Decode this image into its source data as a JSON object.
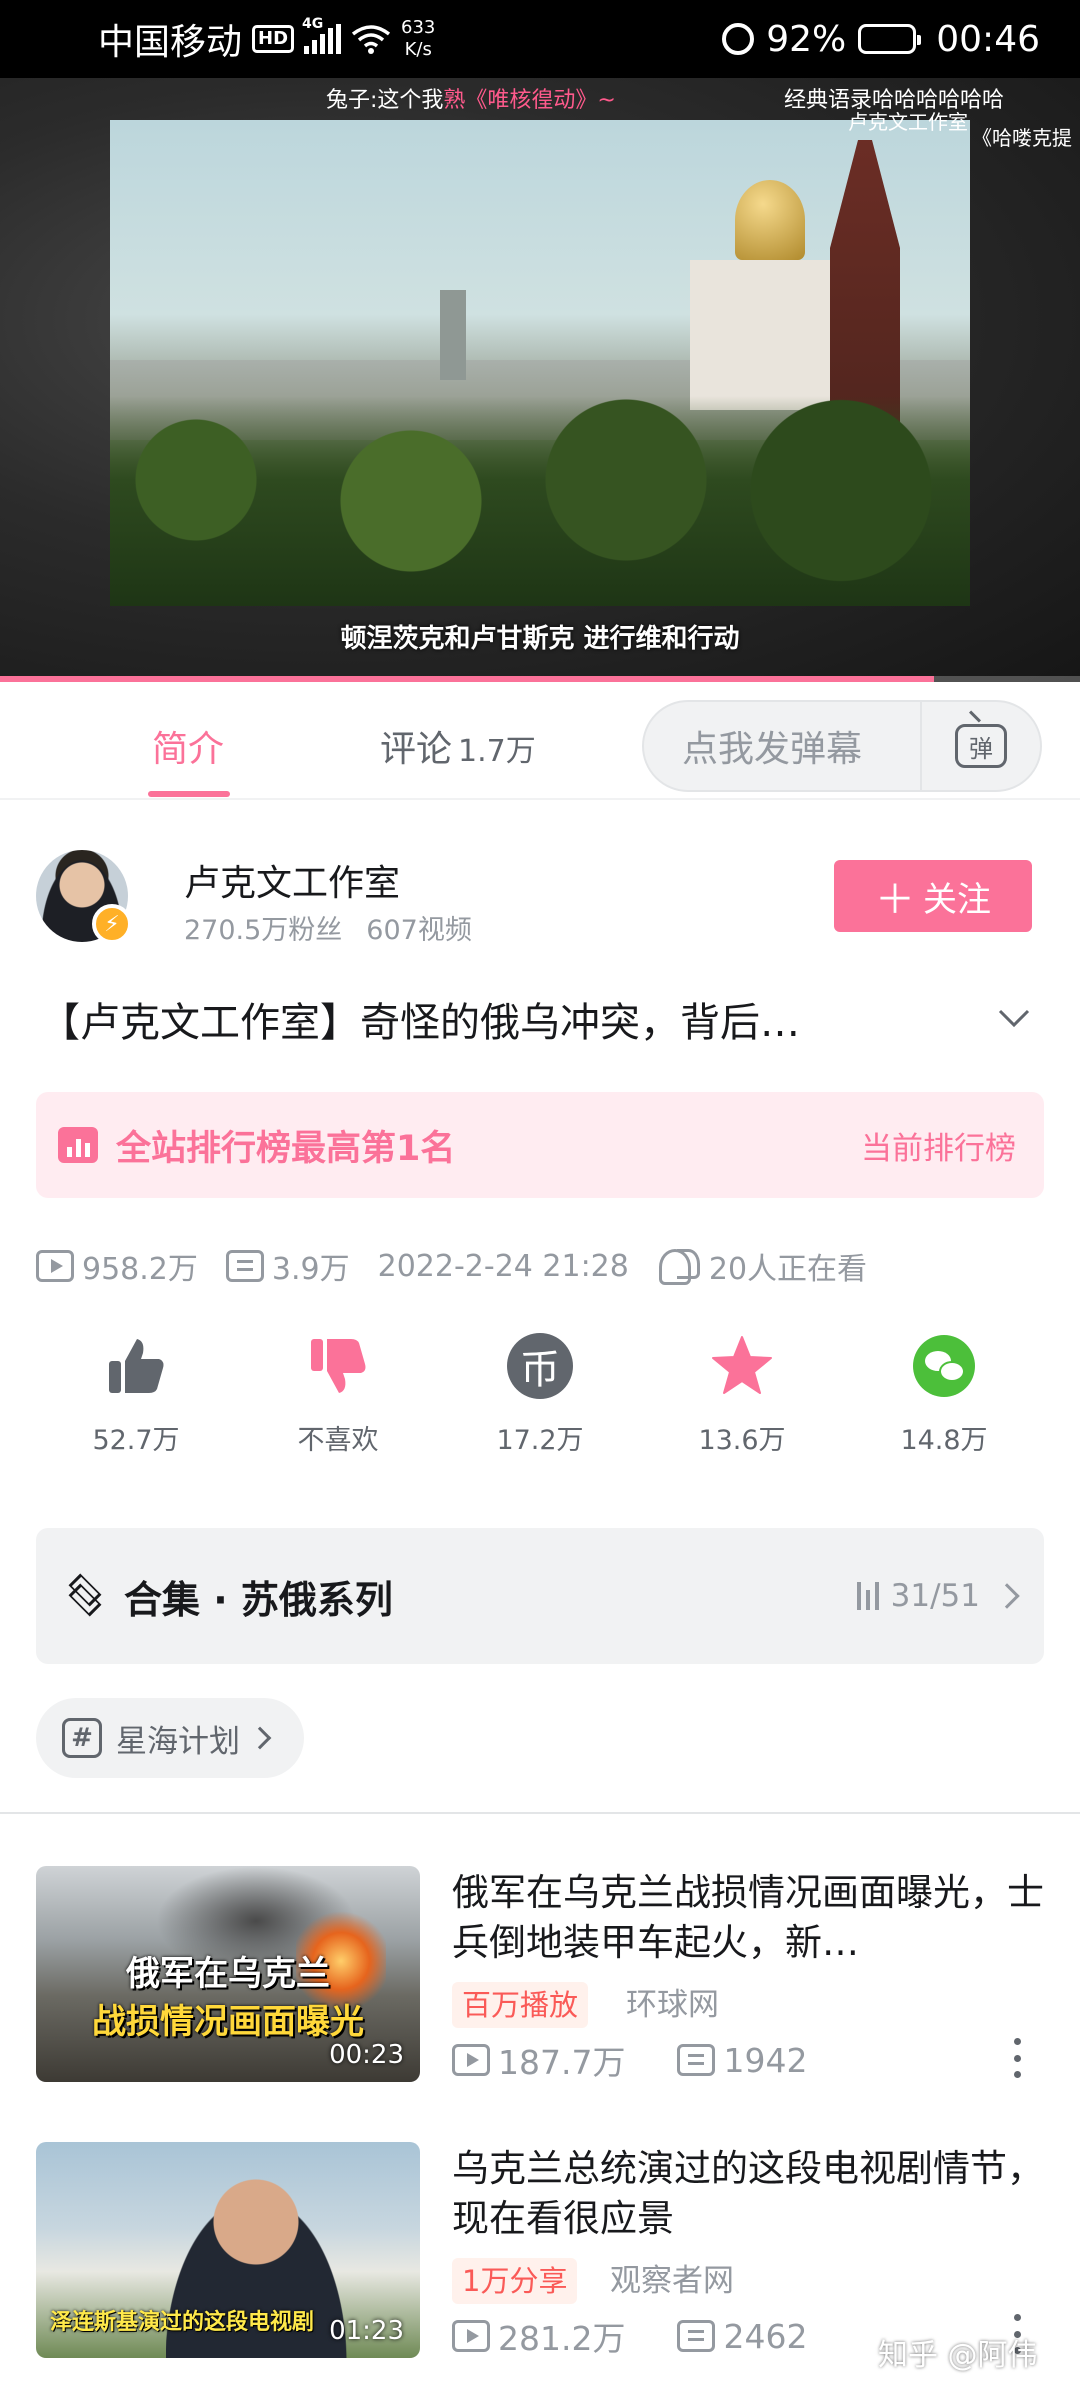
{
  "status_bar": {
    "carrier": "中国移动",
    "hd": "HD",
    "network": "4G",
    "speed_value": "633",
    "speed_unit": "K/s",
    "battery": "92%",
    "battery_level": 0.92,
    "time": "00:46"
  },
  "player": {
    "danmaku": [
      {
        "prefix": "兔子:这个我",
        "highlight": "熟《唯核徨动》~"
      },
      {
        "prefix": "经典语录哈哈哈哈哈哈",
        "highlight": ""
      }
    ],
    "watermark_top": "卢克文工作室",
    "watermark_sub": "《哈喽克提",
    "subtitle": "顿涅茨克和卢甘斯克 进行维和行动",
    "progress": 0.865
  },
  "tabs": {
    "intro": "简介",
    "comments": "评论",
    "comments_count": "1.7万",
    "danmaku_placeholder": "点我发弹幕",
    "danmaku_button": "弹"
  },
  "uploader": {
    "name": "卢克文工作室",
    "fans": "270.5万粉丝",
    "videos": "607视频",
    "follow_label": "关注"
  },
  "video": {
    "title": "【卢克文工作室】奇怪的俄乌冲突，背后…"
  },
  "rank": {
    "text": "全站排行榜最高第1名",
    "link": "当前排行榜"
  },
  "stats": {
    "views": "958.2万",
    "danmaku": "3.9万",
    "date": "2022-2-24 21:28",
    "watching": "20人正在看"
  },
  "actions": {
    "like": "52.7万",
    "dislike": "不喜欢",
    "coin": "17.2万",
    "coin_glyph": "币",
    "favorite": "13.6万",
    "share": "14.8万"
  },
  "collection": {
    "title": "合集 · 苏俄系列",
    "progress": "31/51"
  },
  "tag": {
    "label": "星海计划"
  },
  "related": [
    {
      "title": "俄军在乌克兰战损情况画面曝光，士兵倒地装甲车起火，新…",
      "badge": "百万播放",
      "source": "环球网",
      "views": "187.7万",
      "danmaku": "1942",
      "duration": "00:23",
      "thumb_line1": "俄军在乌克兰",
      "thumb_line2": "战损情况画面曝光"
    },
    {
      "title": "乌克兰总统演过的这段电视剧情节，现在看很应景",
      "badge": "1万分享",
      "source": "观察者网",
      "views": "281.2万",
      "danmaku": "2462",
      "duration": "01:23",
      "thumb_line1": "泽连斯基演过的这段电视剧"
    }
  ],
  "watermark": "知乎 @阿伟",
  "colors": {
    "accent": "#fb7299",
    "text": "#18191c",
    "secondary": "#9499a0"
  }
}
